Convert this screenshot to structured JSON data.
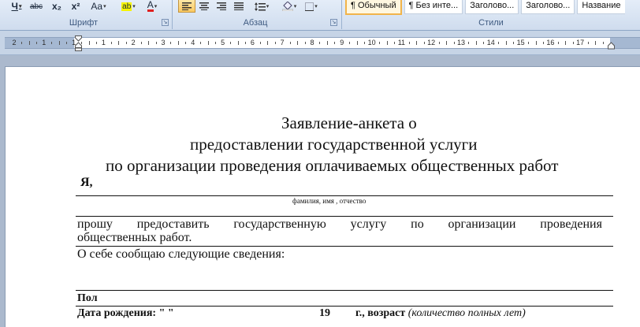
{
  "ribbon": {
    "font_group": {
      "label": "Шрифт",
      "buttons": [
        {
          "name": "underline-button",
          "glyph": "Ч"
        },
        {
          "name": "strikethrough-button",
          "glyph": "abc"
        },
        {
          "name": "subscript-button",
          "glyph": "x₂"
        },
        {
          "name": "superscript-button",
          "glyph": "x²"
        },
        {
          "name": "change-case-button",
          "glyph": "Aa"
        },
        {
          "name": "highlight-button",
          "glyph": "ab"
        },
        {
          "name": "font-color-button",
          "glyph": "A"
        }
      ]
    },
    "paragraph_group": {
      "label": "Абзац"
    },
    "styles_group": {
      "label": "Стили",
      "items": [
        "¶ Обычный",
        "¶ Без инте...",
        "Заголово...",
        "Заголово...",
        "Название"
      ]
    }
  },
  "ruler": {
    "numbers": [
      "2",
      "1",
      "1",
      "1",
      "2",
      "3",
      "4",
      "5",
      "6",
      "7",
      "8",
      "9",
      "10",
      "11",
      "12",
      "13",
      "14",
      "15",
      "16",
      "17"
    ]
  },
  "document": {
    "title_lines": [
      "Заявление-анкета о",
      "предоставлении государственной услуги",
      "по организации проведения оплачиваемых общественных работ"
    ],
    "ya": "Я,",
    "fio_hint": "фамилия, имя   , отчество",
    "request_line1_words": [
      "прошу",
      "предоставить",
      "государственную",
      "услугу",
      "по",
      "организации",
      "проведения"
    ],
    "request_line2": "общественных работ.",
    "about": "О себе сообщаю следующие сведения:",
    "pol": "Пол",
    "birth_label": "Дата рождения:  \"      \"",
    "birth_year": "19",
    "age_bold": "г., возраст",
    "age_italic": "(количество полных лет)"
  }
}
